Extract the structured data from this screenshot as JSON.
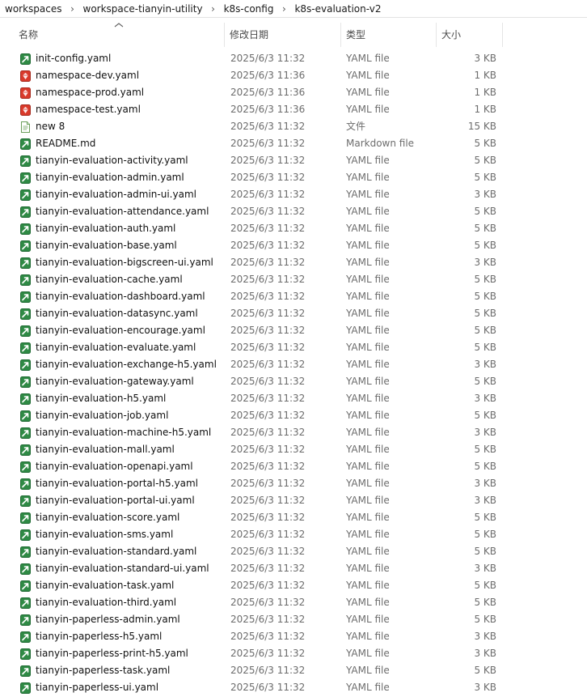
{
  "breadcrumb": {
    "items": [
      "workspaces",
      "workspace-tianyin-utility",
      "k8s-config",
      "k8s-evaluation-v2"
    ],
    "separator": "›"
  },
  "columns": {
    "name": "名称",
    "date": "修改日期",
    "type": "类型",
    "size": "大小"
  },
  "icons": {
    "yaml": "yaml-file-icon",
    "ruby": "ruby-yaml-file-icon",
    "text": "text-file-icon"
  },
  "files": [
    {
      "name": "init-config.yaml",
      "date": "2025/6/3 11:32",
      "type": "YAML file",
      "size": "3 KB",
      "icon": "yaml"
    },
    {
      "name": "namespace-dev.yaml",
      "date": "2025/6/3 11:36",
      "type": "YAML file",
      "size": "1 KB",
      "icon": "ruby"
    },
    {
      "name": "namespace-prod.yaml",
      "date": "2025/6/3 11:36",
      "type": "YAML file",
      "size": "1 KB",
      "icon": "ruby"
    },
    {
      "name": "namespace-test.yaml",
      "date": "2025/6/3 11:36",
      "type": "YAML file",
      "size": "1 KB",
      "icon": "ruby"
    },
    {
      "name": "new 8",
      "date": "2025/6/3 11:32",
      "type": "文件",
      "size": "15 KB",
      "icon": "text"
    },
    {
      "name": "README.md",
      "date": "2025/6/3 11:32",
      "type": "Markdown file",
      "size": "5 KB",
      "icon": "yaml"
    },
    {
      "name": "tianyin-evaluation-activity.yaml",
      "date": "2025/6/3 11:32",
      "type": "YAML file",
      "size": "5 KB",
      "icon": "yaml"
    },
    {
      "name": "tianyin-evaluation-admin.yaml",
      "date": "2025/6/3 11:32",
      "type": "YAML file",
      "size": "5 KB",
      "icon": "yaml"
    },
    {
      "name": "tianyin-evaluation-admin-ui.yaml",
      "date": "2025/6/3 11:32",
      "type": "YAML file",
      "size": "3 KB",
      "icon": "yaml"
    },
    {
      "name": "tianyin-evaluation-attendance.yaml",
      "date": "2025/6/3 11:32",
      "type": "YAML file",
      "size": "5 KB",
      "icon": "yaml"
    },
    {
      "name": "tianyin-evaluation-auth.yaml",
      "date": "2025/6/3 11:32",
      "type": "YAML file",
      "size": "5 KB",
      "icon": "yaml"
    },
    {
      "name": "tianyin-evaluation-base.yaml",
      "date": "2025/6/3 11:32",
      "type": "YAML file",
      "size": "5 KB",
      "icon": "yaml"
    },
    {
      "name": "tianyin-evaluation-bigscreen-ui.yaml",
      "date": "2025/6/3 11:32",
      "type": "YAML file",
      "size": "3 KB",
      "icon": "yaml"
    },
    {
      "name": "tianyin-evaluation-cache.yaml",
      "date": "2025/6/3 11:32",
      "type": "YAML file",
      "size": "5 KB",
      "icon": "yaml"
    },
    {
      "name": "tianyin-evaluation-dashboard.yaml",
      "date": "2025/6/3 11:32",
      "type": "YAML file",
      "size": "5 KB",
      "icon": "yaml"
    },
    {
      "name": "tianyin-evaluation-datasync.yaml",
      "date": "2025/6/3 11:32",
      "type": "YAML file",
      "size": "5 KB",
      "icon": "yaml"
    },
    {
      "name": "tianyin-evaluation-encourage.yaml",
      "date": "2025/6/3 11:32",
      "type": "YAML file",
      "size": "5 KB",
      "icon": "yaml"
    },
    {
      "name": "tianyin-evaluation-evaluate.yaml",
      "date": "2025/6/3 11:32",
      "type": "YAML file",
      "size": "5 KB",
      "icon": "yaml"
    },
    {
      "name": "tianyin-evaluation-exchange-h5.yaml",
      "date": "2025/6/3 11:32",
      "type": "YAML file",
      "size": "3 KB",
      "icon": "yaml"
    },
    {
      "name": "tianyin-evaluation-gateway.yaml",
      "date": "2025/6/3 11:32",
      "type": "YAML file",
      "size": "5 KB",
      "icon": "yaml"
    },
    {
      "name": "tianyin-evaluation-h5.yaml",
      "date": "2025/6/3 11:32",
      "type": "YAML file",
      "size": "3 KB",
      "icon": "yaml"
    },
    {
      "name": "tianyin-evaluation-job.yaml",
      "date": "2025/6/3 11:32",
      "type": "YAML file",
      "size": "5 KB",
      "icon": "yaml"
    },
    {
      "name": "tianyin-evaluation-machine-h5.yaml",
      "date": "2025/6/3 11:32",
      "type": "YAML file",
      "size": "3 KB",
      "icon": "yaml"
    },
    {
      "name": "tianyin-evaluation-mall.yaml",
      "date": "2025/6/3 11:32",
      "type": "YAML file",
      "size": "5 KB",
      "icon": "yaml"
    },
    {
      "name": "tianyin-evaluation-openapi.yaml",
      "date": "2025/6/3 11:32",
      "type": "YAML file",
      "size": "5 KB",
      "icon": "yaml"
    },
    {
      "name": "tianyin-evaluation-portal-h5.yaml",
      "date": "2025/6/3 11:32",
      "type": "YAML file",
      "size": "3 KB",
      "icon": "yaml"
    },
    {
      "name": "tianyin-evaluation-portal-ui.yaml",
      "date": "2025/6/3 11:32",
      "type": "YAML file",
      "size": "3 KB",
      "icon": "yaml"
    },
    {
      "name": "tianyin-evaluation-score.yaml",
      "date": "2025/6/3 11:32",
      "type": "YAML file",
      "size": "5 KB",
      "icon": "yaml"
    },
    {
      "name": "tianyin-evaluation-sms.yaml",
      "date": "2025/6/3 11:32",
      "type": "YAML file",
      "size": "5 KB",
      "icon": "yaml"
    },
    {
      "name": "tianyin-evaluation-standard.yaml",
      "date": "2025/6/3 11:32",
      "type": "YAML file",
      "size": "5 KB",
      "icon": "yaml"
    },
    {
      "name": "tianyin-evaluation-standard-ui.yaml",
      "date": "2025/6/3 11:32",
      "type": "YAML file",
      "size": "3 KB",
      "icon": "yaml"
    },
    {
      "name": "tianyin-evaluation-task.yaml",
      "date": "2025/6/3 11:32",
      "type": "YAML file",
      "size": "5 KB",
      "icon": "yaml"
    },
    {
      "name": "tianyin-evaluation-third.yaml",
      "date": "2025/6/3 11:32",
      "type": "YAML file",
      "size": "5 KB",
      "icon": "yaml"
    },
    {
      "name": "tianyin-paperless-admin.yaml",
      "date": "2025/6/3 11:32",
      "type": "YAML file",
      "size": "5 KB",
      "icon": "yaml"
    },
    {
      "name": "tianyin-paperless-h5.yaml",
      "date": "2025/6/3 11:32",
      "type": "YAML file",
      "size": "3 KB",
      "icon": "yaml"
    },
    {
      "name": "tianyin-paperless-print-h5.yaml",
      "date": "2025/6/3 11:32",
      "type": "YAML file",
      "size": "3 KB",
      "icon": "yaml"
    },
    {
      "name": "tianyin-paperless-task.yaml",
      "date": "2025/6/3 11:32",
      "type": "YAML file",
      "size": "5 KB",
      "icon": "yaml"
    },
    {
      "name": "tianyin-paperless-ui.yaml",
      "date": "2025/6/3 11:32",
      "type": "YAML file",
      "size": "3 KB",
      "icon": "yaml"
    }
  ]
}
